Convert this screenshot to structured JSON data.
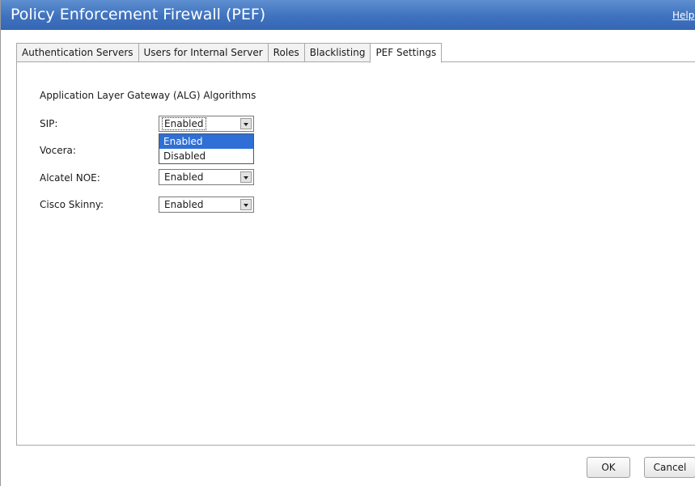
{
  "window": {
    "title": "Policy Enforcement Firewall (PEF)",
    "help_label": "Help"
  },
  "tabs": [
    {
      "label": "Authentication Servers"
    },
    {
      "label": "Users for Internal Server"
    },
    {
      "label": "Roles"
    },
    {
      "label": "Blacklisting"
    },
    {
      "label": "PEF Settings",
      "active": true
    }
  ],
  "section": {
    "heading": "Application Layer Gateway (ALG) Algorithms"
  },
  "fields": {
    "sip": {
      "label": "SIP:",
      "value": "Enabled"
    },
    "vocera": {
      "label": "Vocera:"
    },
    "alcatel": {
      "label": "Alcatel NOE:",
      "value": "Enabled"
    },
    "cisco": {
      "label": "Cisco Skinny:",
      "value": "Enabled"
    }
  },
  "dropdown": {
    "options": [
      "Enabled",
      "Disabled"
    ],
    "highlighted": "Enabled"
  },
  "buttons": {
    "ok": "OK",
    "cancel": "Cancel"
  },
  "colors": {
    "titlebar": "#3f72be",
    "highlight": "#2f6fd6"
  },
  "icons": {
    "dropdown_arrow": "chevron-down-icon"
  }
}
